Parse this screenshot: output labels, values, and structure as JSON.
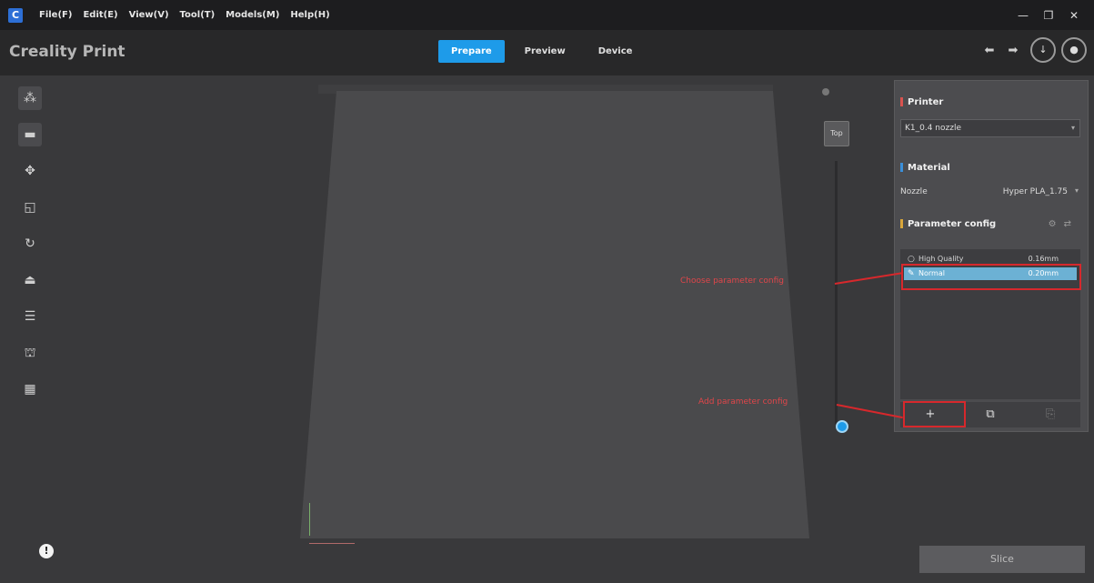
{
  "menubar": {
    "items": [
      "File(F)",
      "Edit(E)",
      "View(V)",
      "Tool(T)",
      "Models(M)",
      "Help(H)"
    ],
    "window_controls": [
      "—",
      "❐",
      "✕"
    ]
  },
  "header": {
    "app_title": "Creality Print",
    "tabs": [
      {
        "label": "Prepare",
        "active": true
      },
      {
        "label": "Preview",
        "active": false
      },
      {
        "label": "Device",
        "active": false
      }
    ],
    "undo_icon": "undo-icon",
    "redo_icon": "redo-icon"
  },
  "left_toolbar": {
    "tools": [
      "add-model-icon",
      "open-folder-icon",
      "move-icon",
      "scale-icon",
      "rotate-icon",
      "lay-flat-icon",
      "mirror-icon",
      "support-icon",
      "arrange-icon"
    ]
  },
  "layer_slider": {
    "top_label": "Top"
  },
  "right_panel": {
    "printer": {
      "title": "Printer",
      "selected": "K1_0.4 nozzle"
    },
    "material": {
      "title": "Material",
      "label": "Nozzle",
      "value": "Hyper PLA_1.75"
    },
    "parameter_config": {
      "title": "Parameter config",
      "rows": [
        {
          "name": "High Quality",
          "value": "0.16mm",
          "selected": false
        },
        {
          "name": "Normal",
          "value": "0.20mm",
          "selected": true
        }
      ]
    },
    "footer": {
      "add_label": "+",
      "import_label": "⧉",
      "delete_label": "⎘"
    }
  },
  "annotations": {
    "edit_label": "Choose parameter config",
    "add_label": "Add parameter config"
  },
  "bottom": {
    "info_label": "!",
    "slice_label": "Slice"
  },
  "colors": {
    "accent": "#1e9be9",
    "annotation_red": "#d7282c",
    "printer_mark": "#d9534f",
    "material_mark": "#3b8fd9",
    "param_mark": "#d9a63b"
  }
}
